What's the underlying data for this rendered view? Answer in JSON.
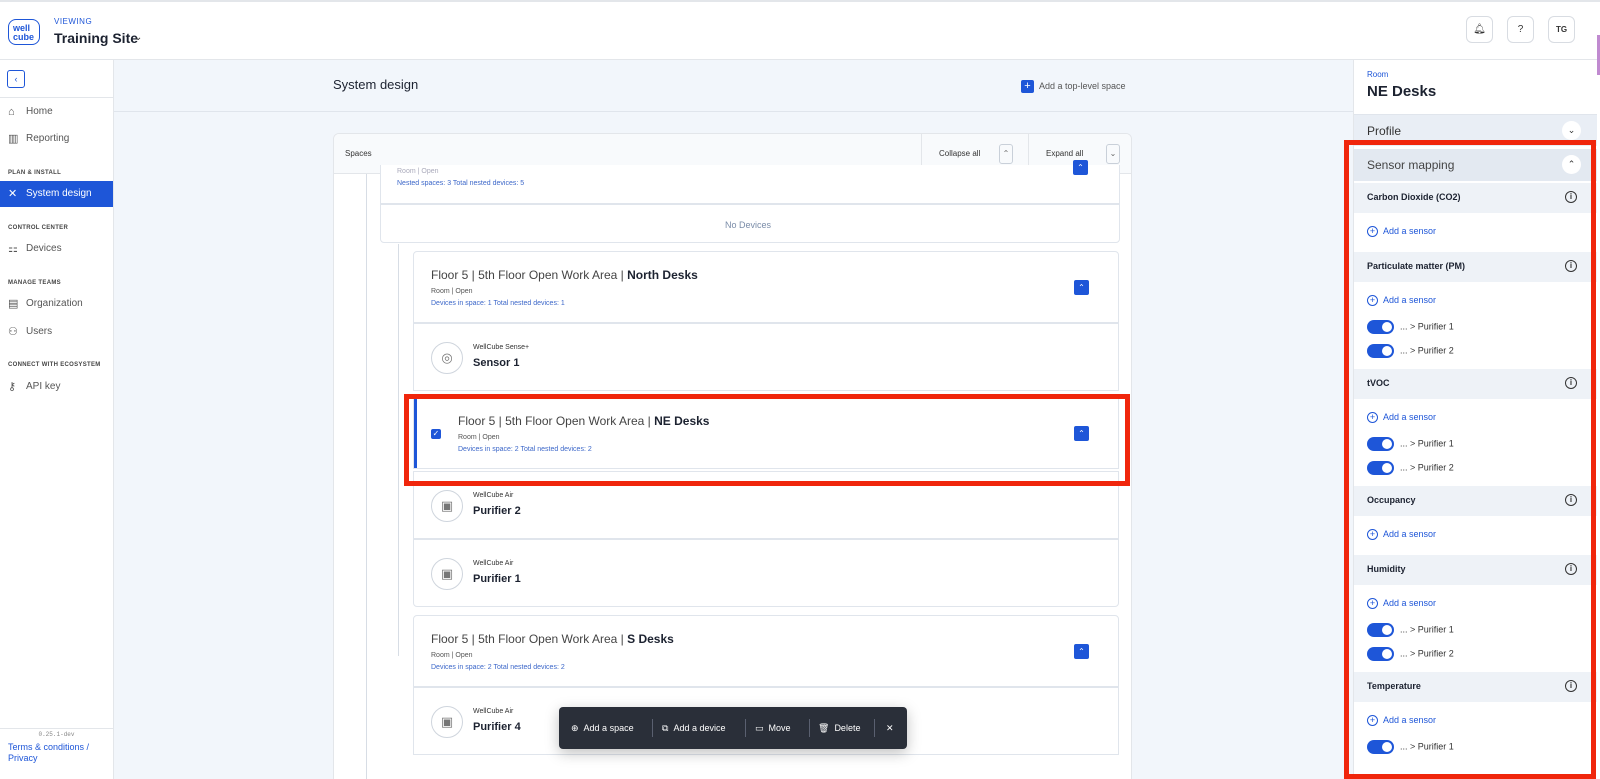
{
  "header": {
    "viewing_label": "VIEWING",
    "site_name": "Training Site",
    "logo_text": "well cube",
    "user_initials": "TG"
  },
  "sidebar": {
    "items": [
      {
        "label": "Home",
        "icon": "home-icon"
      },
      {
        "label": "Reporting",
        "icon": "chart-icon"
      },
      {
        "label": "System design",
        "icon": "tools-icon"
      },
      {
        "label": "Devices",
        "icon": "devices-icon"
      },
      {
        "label": "Organization",
        "icon": "organization-icon"
      },
      {
        "label": "Users",
        "icon": "users-icon"
      },
      {
        "label": "API key",
        "icon": "key-icon"
      }
    ],
    "sections": {
      "plan": "PLAN & INSTALL",
      "control": "CONTROL CENTER",
      "teams": "MANAGE TEAMS",
      "ecosystem": "CONNECT WITH ECOSYSTEM"
    },
    "version": "0.25.1-dev",
    "terms": "Terms & conditions / Privacy"
  },
  "main": {
    "title": "System design",
    "add_top_level": "Add a top-level space",
    "spaces_label": "Spaces",
    "collapse_all": "Collapse all",
    "expand_all": "Expand all",
    "partial_row": {
      "nest": "Nested spaces: 3 Total nested devices: 5",
      "sub_partial": "Room | Open"
    },
    "no_devices": "No Devices",
    "spaces": [
      {
        "path": "Floor 5 | 5th Floor Open Work Area |",
        "name": "North Desks",
        "sub": "Room | Open",
        "nest": "Devices in space: 1 Total nested devices: 1"
      },
      {
        "path": "Floor 5 | 5th Floor Open Work Area |",
        "name": "NE Desks",
        "sub": "Room | Open",
        "nest": "Devices in space: 2 Total nested devices: 2"
      },
      {
        "path": "Floor 5 | 5th Floor Open Work Area |",
        "name": "S Desks",
        "sub": "Room | Open",
        "nest": "Devices in space: 2 Total nested devices: 2"
      }
    ],
    "devices": [
      {
        "type": "WellCube Sense+",
        "name": "Sensor 1"
      },
      {
        "type": "WellCube Air",
        "name": "Purifier 2"
      },
      {
        "type": "WellCube Air",
        "name": "Purifier 1"
      },
      {
        "type": "WellCube Air",
        "name": "Purifier 4"
      }
    ]
  },
  "toolbar": {
    "add_space": "Add a space",
    "add_device": "Add a device",
    "move": "Move",
    "delete": "Delete",
    "close": "✕"
  },
  "panel": {
    "room_label": "Room",
    "room_name": "NE Desks",
    "profile": "Profile",
    "sensor_mapping": "Sensor mapping",
    "add_sensor": "Add a sensor",
    "groups": [
      {
        "name": "Carbon Dioxide (CO2)",
        "toggles": []
      },
      {
        "name": "Particulate matter (PM)",
        "toggles": [
          "... > Purifier 1",
          "... > Purifier 2"
        ]
      },
      {
        "name": "tVOC",
        "toggles": [
          "... > Purifier 1",
          "... > Purifier 2"
        ]
      },
      {
        "name": "Occupancy",
        "toggles": []
      },
      {
        "name": "Humidity",
        "toggles": [
          "... > Purifier 1",
          "... > Purifier 2"
        ]
      },
      {
        "name": "Temperature",
        "toggles": [
          "... > Purifier 1"
        ]
      }
    ]
  },
  "colors": {
    "accent": "#1e56d8",
    "highlight": "#f0260c"
  }
}
